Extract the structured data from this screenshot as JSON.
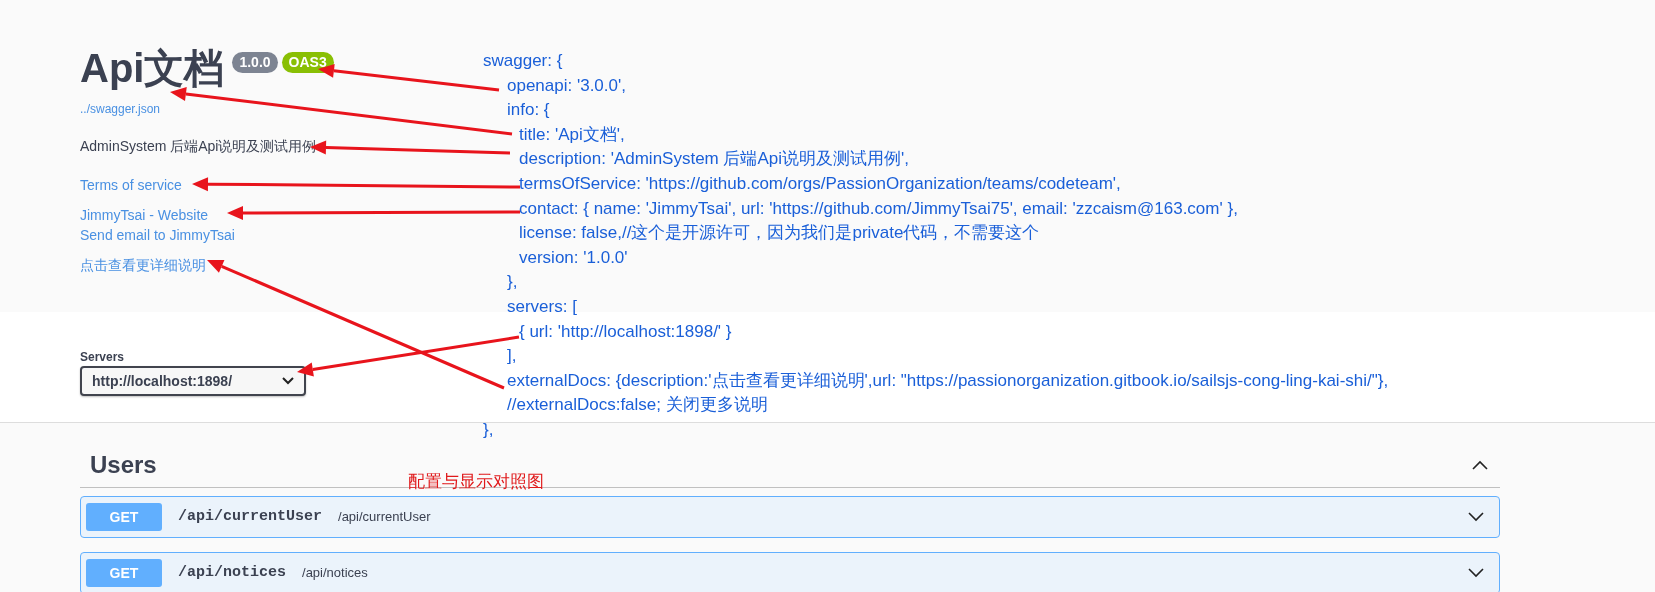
{
  "info": {
    "title": "Api文档",
    "version": "1.0.0",
    "oas_badge": "OAS3",
    "spec_link": "../swagger.json",
    "description": "AdminSystem 后端Api说明及测试用例",
    "terms_link": "Terms of service",
    "contact_links": [
      "JimmyTsai - Website",
      "Send email to JimmyTsai"
    ],
    "external_docs_link": "点击查看更详细说明"
  },
  "servers": {
    "label": "Servers",
    "value": "http://localhost:1898/"
  },
  "tag": {
    "name": "Users",
    "expanded": true,
    "operations": [
      {
        "method": "GET",
        "path": "/api/currentUser",
        "summary": "/api/currentUser",
        "expanded": false
      },
      {
        "method": "GET",
        "path": "/api/notices",
        "summary": "/api/notices",
        "expanded": false
      }
    ]
  },
  "annotation": {
    "caption": "配置与显示对照图",
    "code": [
      {
        "text": "swagger: {",
        "close": "},",
        "children": [
          {
            "text": "openapi: '3.0.0',"
          },
          {
            "text": "info: {",
            "close": "},",
            "children": [
              {
                "text": "title: 'Api文档',"
              },
              {
                "text": "description: 'AdminSystem 后端Api说明及测试用例',"
              },
              {
                "text": "termsOfService: 'https://github.com/orgs/PassionOrganization/teams/codeteam',"
              },
              {
                "text": "contact: { name: 'JimmyTsai', url: 'https://github.com/JimmyTsai75', email: 'zzcaism@163.com' },"
              },
              {
                "text": "license: false,//这个是开源许可，因为我们是private代码，不需要这个"
              },
              {
                "text": "version: '1.0.0'"
              }
            ]
          },
          {
            "text": "servers: [",
            "close": "],",
            "children": [
              {
                "text": "{ url: 'http://localhost:1898/' }"
              }
            ]
          },
          {
            "text": "externalDocs: {description:'点击查看更详细说明',url: \"https://passionorganization.gitbook.io/sailsjs-cong-ling-kai-shi/\"},"
          },
          {
            "text": "//externalDocs:false; 关闭更多说明"
          }
        ]
      }
    ]
  }
}
